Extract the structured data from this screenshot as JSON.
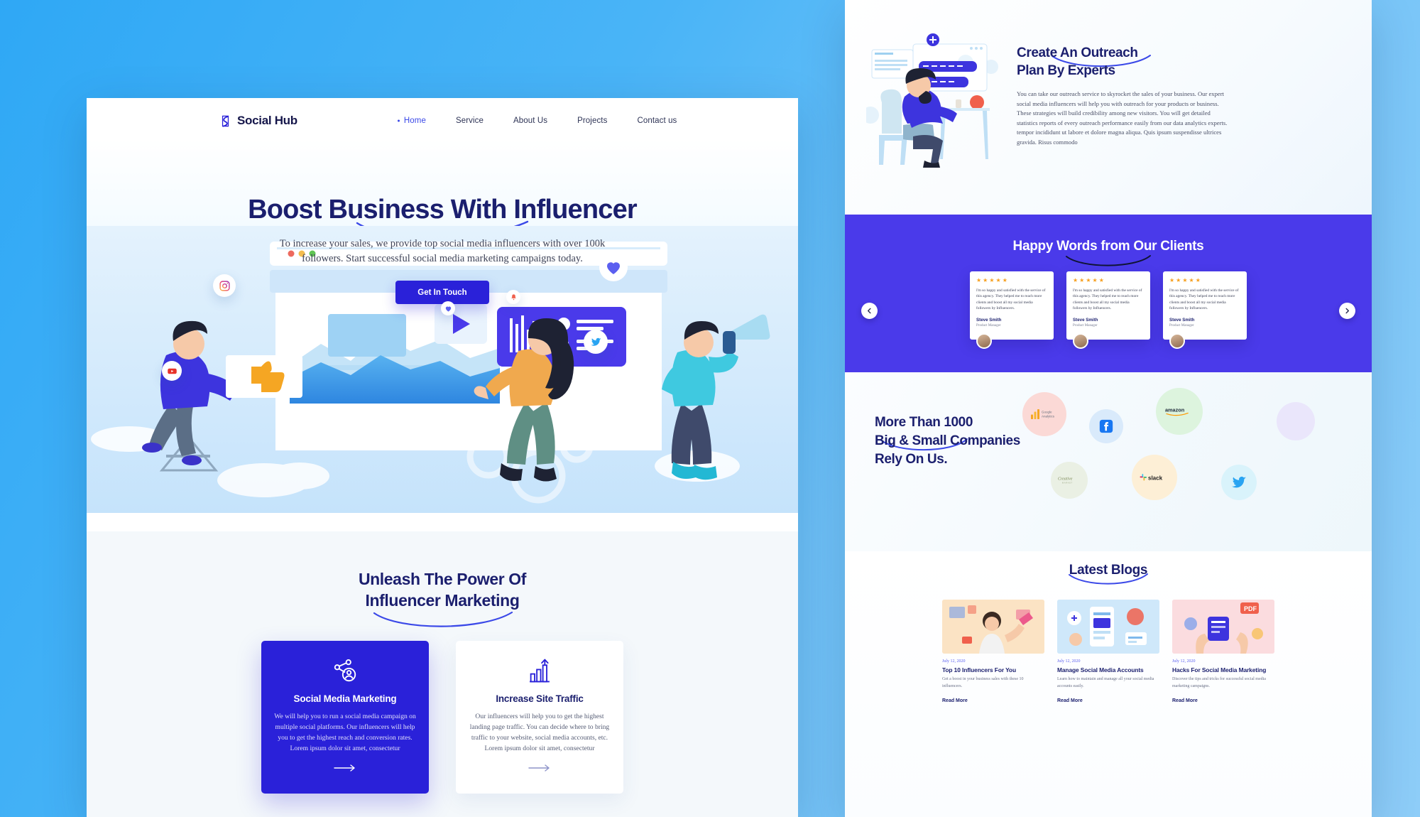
{
  "theme": {
    "page_bg_blue": "#49B4F7",
    "brand_blue": "#2A21D9",
    "testimonial_bg": "#4A3AEA",
    "heading_navy": "#1B1F6E",
    "star_orange": "#F6A020"
  },
  "left_page": {
    "nav": {
      "logo_text": "Social Hub",
      "logo_icon": "social-hub-logo-icon",
      "links": [
        {
          "label": "Home",
          "active": true
        },
        {
          "label": "Service",
          "active": false
        },
        {
          "label": "About Us",
          "active": false
        },
        {
          "label": "Projects",
          "active": false
        },
        {
          "label": "Contact us",
          "active": false
        }
      ]
    },
    "hero": {
      "title": "Boost Business With Influencer",
      "subtitle": "To increase your sales, we provide top social media influencers with over 100k followers. Start successful social media marketing campaigns today.",
      "cta_label": "Get In Touch",
      "floating_icons": [
        {
          "name": "instagram-icon"
        },
        {
          "name": "youtube-icon"
        },
        {
          "name": "twitter-icon"
        },
        {
          "name": "heart-icon"
        },
        {
          "name": "bell-icon"
        }
      ],
      "illustration": "influencer-marketing-team-illustration"
    },
    "features": {
      "title_line1": "Unleash The Power Of",
      "title_line2": "Influencer Marketing",
      "cards": [
        {
          "icon": "share-network-user-icon",
          "title": "Social Media Marketing",
          "body": "We will help you to run a social media campaign on multiple social platforms. Our influencers will help you to get the highest reach and conversion rates. Lorem ipsum dolor sit amet, consectetur",
          "arrow": "arrow-right-icon",
          "style": "primary"
        },
        {
          "icon": "bar-chart-growth-icon",
          "title": "Increase Site Traffic",
          "body": "Our influencers will help you to get the highest landing page traffic. You can decide where to bring traffic to your website, social media accounts, etc. Lorem ipsum dolor sit amet, consectetur",
          "arrow": "arrow-right-icon",
          "style": "light"
        }
      ]
    }
  },
  "right_page": {
    "outreach": {
      "title_line1": "Create An Outreach",
      "title_line2": "Plan By Experts",
      "body": "You can take our outreach service to skyrocket the sales of your business. Our expert social media influencers will help you with outreach for your products or business. These strategies will build credibility among new visitors. You will get detailed statistics reports of every outreach performance easily from our data analytics experts. tempor incididunt ut labore et dolore magna aliqua. Quis ipsum suspendisse ultrices gravida. Risus commodo",
      "illustration": "man-at-desk-outreach-illustration"
    },
    "testimonials": {
      "title": "Happy Words from Our Clients",
      "prev_icon": "chevron-left-icon",
      "next_icon": "chevron-right-icon",
      "stars": "★★★★★",
      "cards": [
        {
          "quote": "I'm so happy and satisfied with the service of this agency. They helped me to reach more clients and boost all my social media followers by Influencers.",
          "name": "Steve Smith",
          "role": "Product Manager"
        },
        {
          "quote": "I'm so happy and satisfied with the service of this agency. They helped me to reach more clients and boost all my social media followers by Influencers.",
          "name": "Steve Smith",
          "role": "Product Manager"
        },
        {
          "quote": "I'm so happy and satisfied with the service of this agency. They helped me to reach more clients and boost all my social media followers by Influencers.",
          "name": "Steve Smith",
          "role": "Product Manager"
        }
      ]
    },
    "clients": {
      "title_line1": "More Than 1000",
      "title_line2": "Big & Small Companies",
      "title_line3": "Rely On Us.",
      "brands": [
        {
          "name": "google-analytics-logo",
          "label": "Google Analytics",
          "bubble_color": "#FBD9D6"
        },
        {
          "name": "facebook-logo",
          "label": "Facebook",
          "bubble_color": "#D9EAFB"
        },
        {
          "name": "amazon-logo",
          "label": "amazon",
          "bubble_color": "#DDF4DE"
        },
        {
          "name": "creative-market-logo",
          "label": "Creative Market",
          "bubble_color": "#EAF0E4"
        },
        {
          "name": "slack-logo",
          "label": "slack",
          "bubble_color": "#FDEFD6"
        },
        {
          "name": "twitter-logo",
          "label": "Twitter",
          "bubble_color": "#D9F3FB"
        },
        {
          "name": "partner-logo",
          "label": "",
          "bubble_color": "#EAE6FB"
        }
      ]
    },
    "blogs": {
      "title": "Latest Blogs",
      "posts": [
        {
          "date": "July 12, 2020",
          "title": "Top 10 Influencers For You",
          "desc": "Get a boost in your business sales with these 10 influencers.",
          "read_more": "Read More",
          "thumb": "woman-with-megaphone-thumbnail",
          "thumb_color": "#FBE3C4"
        },
        {
          "date": "July 12, 2020",
          "title": "Manage Social Media Accounts",
          "desc": "Learn how to maintain and manage all your social media accounts easily.",
          "read_more": "Read More",
          "thumb": "social-dashboard-thumbnail",
          "thumb_color": "#CFE8FA"
        },
        {
          "date": "July 12, 2020",
          "title": "Hacks For Social Media Marketing",
          "desc": "Discover the tips and tricks for successful social media marketing campaigns.",
          "read_more": "Read More",
          "thumb": "hands-with-devices-thumbnail",
          "thumb_color": "#FBDCDF"
        }
      ]
    }
  }
}
